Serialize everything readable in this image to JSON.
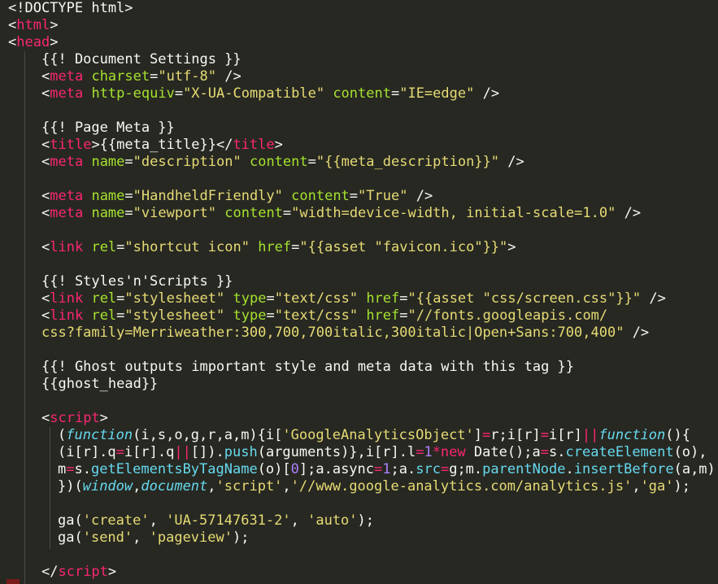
{
  "editor": {
    "theme": "Monokai",
    "colors": {
      "background": "#272822",
      "text": "#F8F8F2",
      "tag": "#F92672",
      "attribute": "#A6E22E",
      "string": "#E6DB74",
      "keyword": "#66D9EF",
      "number": "#AE81FF"
    },
    "lines": [
      {
        "indent": 0,
        "tokens": [
          [
            "t-pun",
            "<!DOCTYPE html>"
          ]
        ]
      },
      {
        "indent": 0,
        "tokens": [
          [
            "t-pun",
            "<"
          ],
          [
            "t-tag",
            "html"
          ],
          [
            "t-pun",
            ">"
          ]
        ]
      },
      {
        "indent": 0,
        "tokens": [
          [
            "t-pun",
            "<"
          ],
          [
            "t-tag",
            "head"
          ],
          [
            "t-pun",
            ">"
          ]
        ]
      },
      {
        "indent": 1,
        "tokens": [
          [
            "t-pun",
            "{{! Document Settings }}"
          ]
        ]
      },
      {
        "indent": 1,
        "tokens": [
          [
            "t-pun",
            "<"
          ],
          [
            "t-tag",
            "meta"
          ],
          [
            "t-pun",
            " "
          ],
          [
            "t-attr",
            "charset"
          ],
          [
            "t-pun",
            "="
          ],
          [
            "t-str",
            "\"utf-8\""
          ],
          [
            "t-pun",
            " />"
          ]
        ]
      },
      {
        "indent": 1,
        "tokens": [
          [
            "t-pun",
            "<"
          ],
          [
            "t-tag",
            "meta"
          ],
          [
            "t-pun",
            " "
          ],
          [
            "t-attr",
            "http-equiv"
          ],
          [
            "t-pun",
            "="
          ],
          [
            "t-str",
            "\"X-UA-Compatible\""
          ],
          [
            "t-pun",
            " "
          ],
          [
            "t-attr",
            "content"
          ],
          [
            "t-pun",
            "="
          ],
          [
            "t-str",
            "\"IE=edge\""
          ],
          [
            "t-pun",
            " />"
          ]
        ]
      },
      {
        "indent": 0,
        "tokens": []
      },
      {
        "indent": 1,
        "tokens": [
          [
            "t-pun",
            "{{! Page Meta }}"
          ]
        ]
      },
      {
        "indent": 1,
        "tokens": [
          [
            "t-pun",
            "<"
          ],
          [
            "t-tag",
            "title"
          ],
          [
            "t-pun",
            ">{{meta_title}}</"
          ],
          [
            "t-tag",
            "title"
          ],
          [
            "t-pun",
            ">"
          ]
        ]
      },
      {
        "indent": 1,
        "tokens": [
          [
            "t-pun",
            "<"
          ],
          [
            "t-tag",
            "meta"
          ],
          [
            "t-pun",
            " "
          ],
          [
            "t-attr",
            "name"
          ],
          [
            "t-pun",
            "="
          ],
          [
            "t-str",
            "\"description\""
          ],
          [
            "t-pun",
            " "
          ],
          [
            "t-attr",
            "content"
          ],
          [
            "t-pun",
            "="
          ],
          [
            "t-str",
            "\"{{meta_description}}\""
          ],
          [
            "t-pun",
            " />"
          ]
        ]
      },
      {
        "indent": 0,
        "tokens": []
      },
      {
        "indent": 1,
        "tokens": [
          [
            "t-pun",
            "<"
          ],
          [
            "t-tag",
            "meta"
          ],
          [
            "t-pun",
            " "
          ],
          [
            "t-attr",
            "name"
          ],
          [
            "t-pun",
            "="
          ],
          [
            "t-str",
            "\"HandheldFriendly\""
          ],
          [
            "t-pun",
            " "
          ],
          [
            "t-attr",
            "content"
          ],
          [
            "t-pun",
            "="
          ],
          [
            "t-str",
            "\"True\""
          ],
          [
            "t-pun",
            " />"
          ]
        ]
      },
      {
        "indent": 1,
        "tokens": [
          [
            "t-pun",
            "<"
          ],
          [
            "t-tag",
            "meta"
          ],
          [
            "t-pun",
            " "
          ],
          [
            "t-attr",
            "name"
          ],
          [
            "t-pun",
            "="
          ],
          [
            "t-str",
            "\"viewport\""
          ],
          [
            "t-pun",
            " "
          ],
          [
            "t-attr",
            "content"
          ],
          [
            "t-pun",
            "="
          ],
          [
            "t-str",
            "\"width=device-width, initial-scale=1.0\""
          ],
          [
            "t-pun",
            " />"
          ]
        ]
      },
      {
        "indent": 0,
        "tokens": []
      },
      {
        "indent": 1,
        "tokens": [
          [
            "t-pun",
            "<"
          ],
          [
            "t-tag",
            "link"
          ],
          [
            "t-pun",
            " "
          ],
          [
            "t-attr",
            "rel"
          ],
          [
            "t-pun",
            "="
          ],
          [
            "t-str",
            "\"shortcut icon\""
          ],
          [
            "t-pun",
            " "
          ],
          [
            "t-attr",
            "href"
          ],
          [
            "t-pun",
            "="
          ],
          [
            "t-str",
            "\"{{asset \"favicon.ico\"}}\""
          ],
          [
            "t-pun",
            ">"
          ]
        ]
      },
      {
        "indent": 0,
        "tokens": []
      },
      {
        "indent": 1,
        "tokens": [
          [
            "t-pun",
            "{{! Styles'n'Scripts }}"
          ]
        ]
      },
      {
        "indent": 1,
        "tokens": [
          [
            "t-pun",
            "<"
          ],
          [
            "t-tag",
            "link"
          ],
          [
            "t-pun",
            " "
          ],
          [
            "t-attr",
            "rel"
          ],
          [
            "t-pun",
            "="
          ],
          [
            "t-str",
            "\"stylesheet\""
          ],
          [
            "t-pun",
            " "
          ],
          [
            "t-attr",
            "type"
          ],
          [
            "t-pun",
            "="
          ],
          [
            "t-str",
            "\"text/css\""
          ],
          [
            "t-pun",
            " "
          ],
          [
            "t-attr",
            "href"
          ],
          [
            "t-pun",
            "="
          ],
          [
            "t-str",
            "\"{{asset \"css/screen.css\"}}\""
          ],
          [
            "t-pun",
            " />"
          ]
        ]
      },
      {
        "indent": 1,
        "tokens": [
          [
            "t-pun",
            "<"
          ],
          [
            "t-tag",
            "link"
          ],
          [
            "t-pun",
            " "
          ],
          [
            "t-attr",
            "rel"
          ],
          [
            "t-pun",
            "="
          ],
          [
            "t-str",
            "\"stylesheet\""
          ],
          [
            "t-pun",
            " "
          ],
          [
            "t-attr",
            "type"
          ],
          [
            "t-pun",
            "="
          ],
          [
            "t-str",
            "\"text/css\""
          ],
          [
            "t-pun",
            " "
          ],
          [
            "t-attr",
            "href"
          ],
          [
            "t-pun",
            "="
          ],
          [
            "t-str",
            "\"//fonts.googleapis.com/"
          ]
        ]
      },
      {
        "indent": 1,
        "tokens": [
          [
            "t-str",
            "css?family=Merriweather:300,700,700italic,300italic|Open+Sans:700,400\""
          ],
          [
            "t-pun",
            " />"
          ]
        ]
      },
      {
        "indent": 0,
        "tokens": []
      },
      {
        "indent": 1,
        "tokens": [
          [
            "t-pun",
            "{{! Ghost outputs important style and meta data with this tag }}"
          ]
        ]
      },
      {
        "indent": 1,
        "tokens": [
          [
            "t-pun",
            "{{ghost_head}}"
          ]
        ]
      },
      {
        "indent": 0,
        "tokens": []
      },
      {
        "indent": 1,
        "tokens": [
          [
            "t-pun",
            "<"
          ],
          [
            "t-tag",
            "script"
          ],
          [
            "t-pun",
            ">"
          ]
        ]
      },
      {
        "indent": 2,
        "tokens": [
          [
            "t-pun",
            "("
          ],
          [
            "t-kw",
            "function"
          ],
          [
            "t-pun",
            "(i,s,o,g,r,a,m){i["
          ],
          [
            "t-str",
            "'GoogleAnalyticsObject'"
          ],
          [
            "t-pun",
            "]"
          ],
          [
            "t-op",
            "="
          ],
          [
            "t-pun",
            "r;i[r]"
          ],
          [
            "t-op",
            "="
          ],
          [
            "t-pun",
            "i[r]"
          ],
          [
            "t-op",
            "||"
          ],
          [
            "t-kw",
            "function"
          ],
          [
            "t-pun",
            "(){"
          ]
        ]
      },
      {
        "indent": 2,
        "tokens": [
          [
            "t-pun",
            "(i[r].q"
          ],
          [
            "t-op",
            "="
          ],
          [
            "t-pun",
            "i[r].q"
          ],
          [
            "t-op",
            "||"
          ],
          [
            "t-pun",
            "[])."
          ],
          [
            "t-fn",
            "push"
          ],
          [
            "t-pun",
            "(arguments)},i[r].l"
          ],
          [
            "t-op",
            "="
          ],
          [
            "t-num",
            "1"
          ],
          [
            "t-op",
            "*new"
          ],
          [
            "t-pun",
            " Date();a"
          ],
          [
            "t-op",
            "="
          ],
          [
            "t-pun",
            "s."
          ],
          [
            "t-fn",
            "createElement"
          ],
          [
            "t-pun",
            "(o),"
          ]
        ]
      },
      {
        "indent": 2,
        "tokens": [
          [
            "t-pun",
            "m"
          ],
          [
            "t-op",
            "="
          ],
          [
            "t-pun",
            "s."
          ],
          [
            "t-fn",
            "getElementsByTagName"
          ],
          [
            "t-pun",
            "(o)["
          ],
          [
            "t-num",
            "0"
          ],
          [
            "t-pun",
            "];a.async"
          ],
          [
            "t-op",
            "="
          ],
          [
            "t-num",
            "1"
          ],
          [
            "t-pun",
            ";a."
          ],
          [
            "t-fn",
            "src"
          ],
          [
            "t-op",
            "="
          ],
          [
            "t-pun",
            "g;m."
          ],
          [
            "t-fn",
            "parentNode"
          ],
          [
            "t-pun",
            "."
          ],
          [
            "t-fn",
            "insertBefore"
          ],
          [
            "t-pun",
            "(a,m)"
          ]
        ]
      },
      {
        "indent": 2,
        "tokens": [
          [
            "t-pun",
            "})("
          ],
          [
            "t-ital",
            "window"
          ],
          [
            "t-pun",
            ","
          ],
          [
            "t-ital",
            "document"
          ],
          [
            "t-pun",
            ","
          ],
          [
            "t-str",
            "'script'"
          ],
          [
            "t-pun",
            ","
          ],
          [
            "t-str",
            "'//www.google-analytics.com/analytics.js'"
          ],
          [
            "t-pun",
            ","
          ],
          [
            "t-str",
            "'ga'"
          ],
          [
            "t-pun",
            ");"
          ]
        ]
      },
      {
        "indent": 0,
        "tokens": []
      },
      {
        "indent": 2,
        "tokens": [
          [
            "t-pun",
            "ga("
          ],
          [
            "t-str",
            "'create'"
          ],
          [
            "t-pun",
            ", "
          ],
          [
            "t-str",
            "'UA-57147631-2'"
          ],
          [
            "t-pun",
            ", "
          ],
          [
            "t-str",
            "'auto'"
          ],
          [
            "t-pun",
            ");"
          ]
        ]
      },
      {
        "indent": 2,
        "tokens": [
          [
            "t-pun",
            "ga("
          ],
          [
            "t-str",
            "'send'"
          ],
          [
            "t-pun",
            ", "
          ],
          [
            "t-str",
            "'pageview'"
          ],
          [
            "t-pun",
            ");"
          ]
        ]
      },
      {
        "indent": 0,
        "tokens": []
      },
      {
        "indent": 1,
        "tokens": [
          [
            "t-pun",
            "</"
          ],
          [
            "t-tag",
            "script"
          ],
          [
            "t-pun",
            ">"
          ]
        ]
      }
    ]
  }
}
